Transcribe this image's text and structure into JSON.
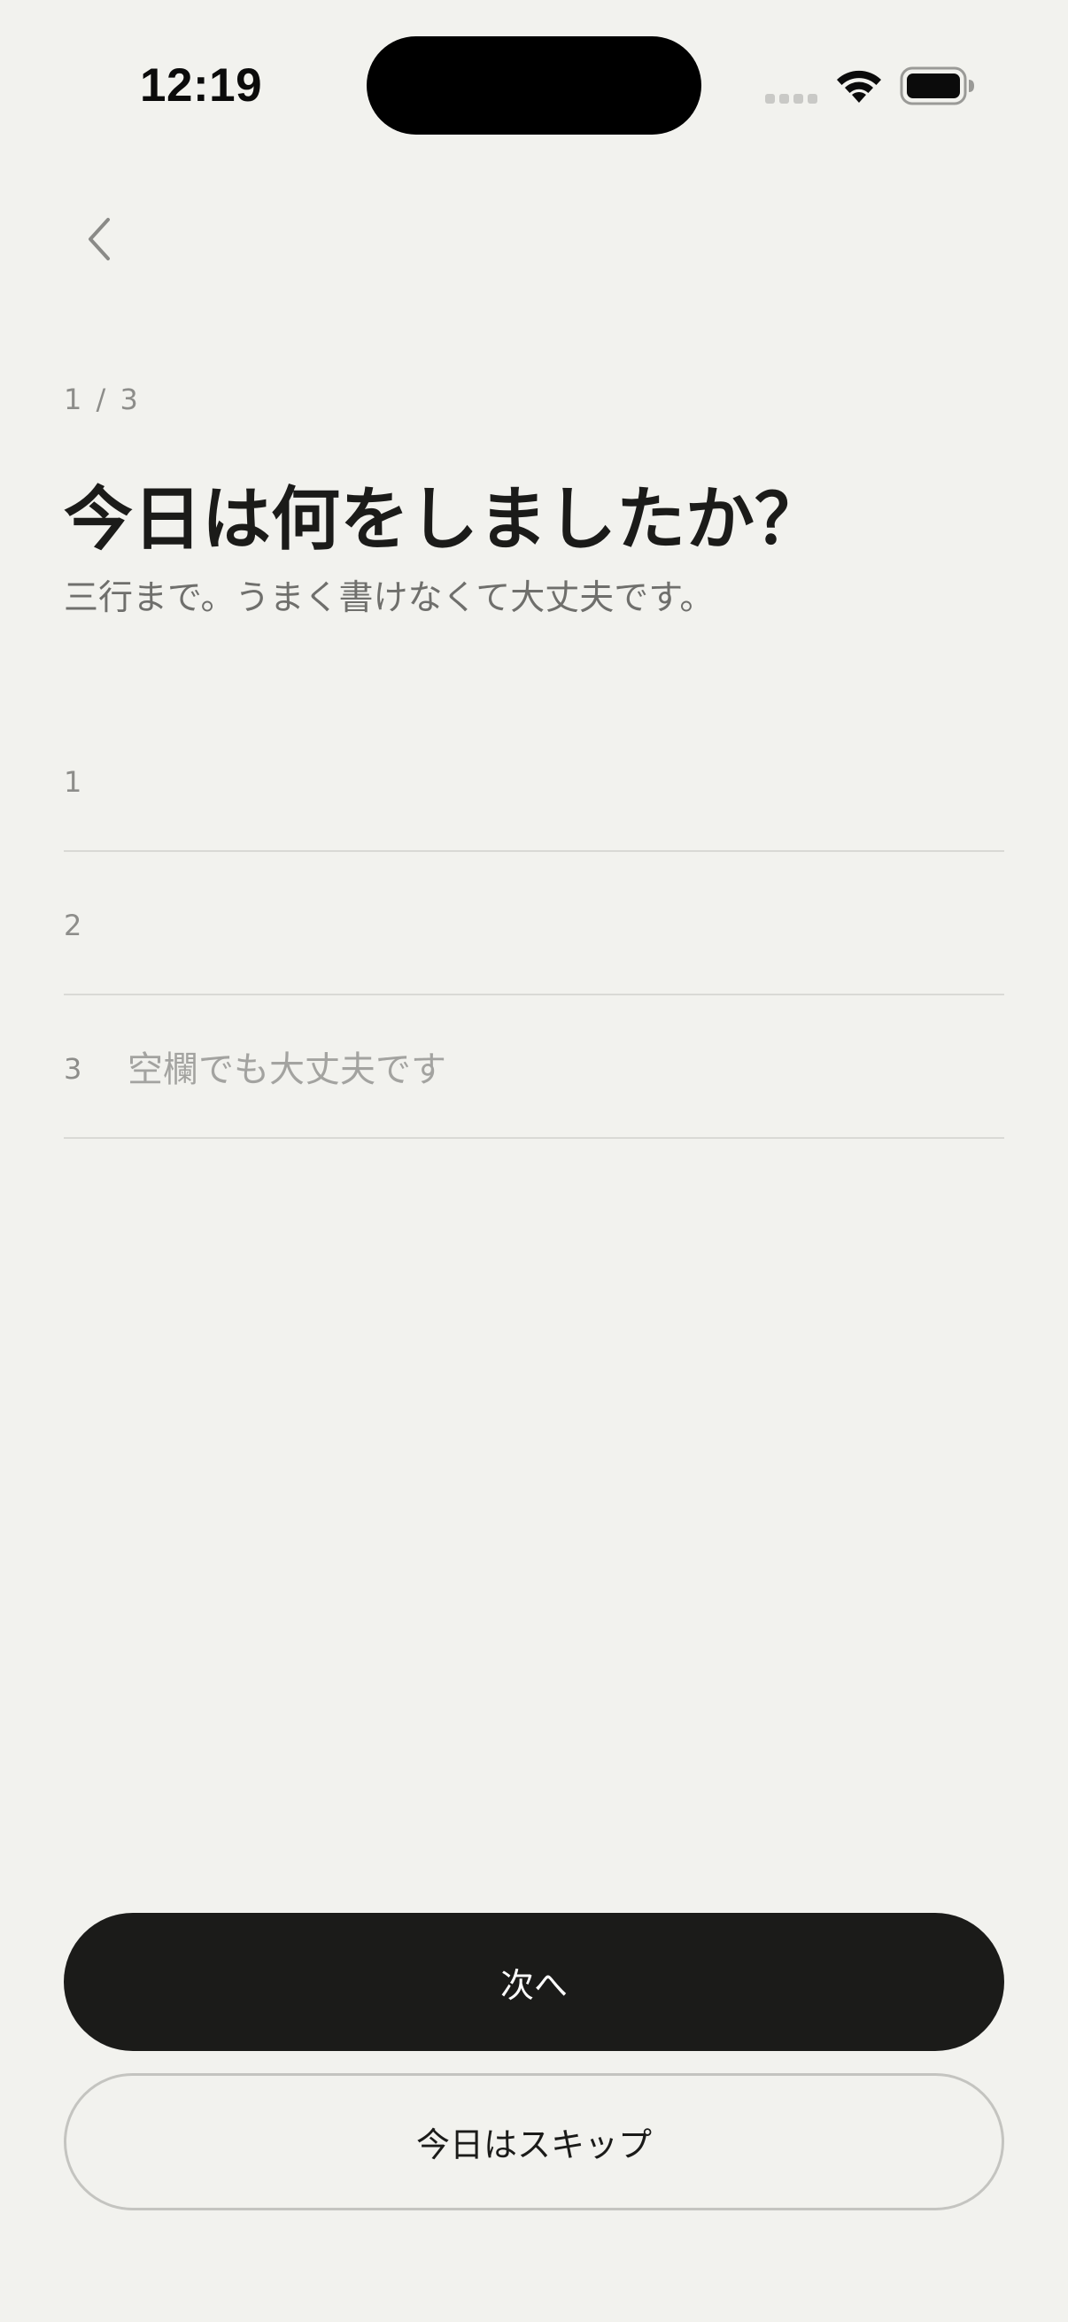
{
  "status_bar": {
    "time": "12:19",
    "icons": [
      "cellular-signal-icon",
      "wifi-icon",
      "battery-icon"
    ]
  },
  "nav": {
    "back_icon": "chevron-left-icon"
  },
  "progress": "1 / 3",
  "title": "今日は何をしましたか？",
  "subtitle": "三行まで。うまく書けなくて大丈夫です。",
  "entries": [
    {
      "number": "1",
      "value": "",
      "placeholder": ""
    },
    {
      "number": "2",
      "value": "",
      "placeholder": ""
    },
    {
      "number": "3",
      "value": "",
      "placeholder": "空欄でも大丈夫です"
    }
  ],
  "buttons": {
    "next_label": "次へ",
    "skip_label": "今日はスキップ"
  },
  "colors": {
    "background": "#f2f2ee",
    "primary_button": "#1b1b19",
    "divider": "#d9d9d5",
    "muted_text": "#8d8d8a"
  }
}
